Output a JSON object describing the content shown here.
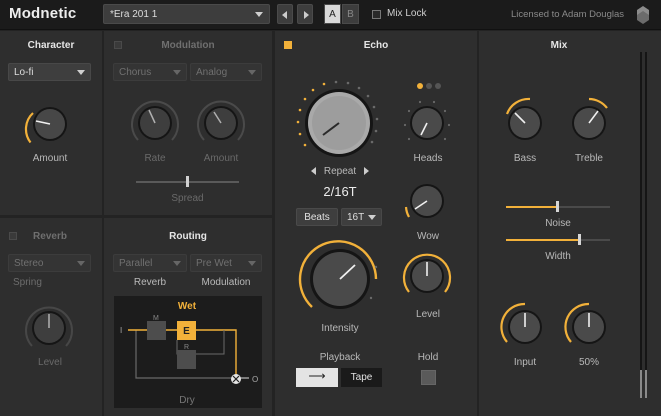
{
  "app": {
    "name": "Modnetic"
  },
  "topbar": {
    "preset": "*Era 201 1",
    "ab_a": "A",
    "ab_b": "B",
    "mix_lock": "Mix Lock",
    "license": "Licensed to Adam Douglas"
  },
  "character": {
    "title": "Character",
    "mode": "Lo-fi",
    "knob_label": "Amount"
  },
  "modulation": {
    "title": "Modulation",
    "type": "Chorus",
    "source": "Analog",
    "rate_label": "Rate",
    "amount_label": "Amount",
    "spread_label": "Spread"
  },
  "echo": {
    "title": "Echo",
    "repeat_label": "Repeat",
    "repeat_value": "2/16T",
    "beats_label": "Beats",
    "division": "16T",
    "heads_label": "Heads",
    "wow_label": "Wow",
    "intensity_label": "Intensity",
    "level_label": "Level",
    "playback_label": "Playback",
    "playback_arrow": "⟶",
    "tape_label": "Tape",
    "hold_label": "Hold"
  },
  "reverb": {
    "title": "Reverb",
    "type": "Stereo",
    "kind": "Spring",
    "level_label": "Level"
  },
  "routing": {
    "title": "Routing",
    "mode": "Parallel",
    "reverb_label": "Reverb",
    "position": "Pre Wet",
    "modulation_label": "Modulation",
    "diagram": {
      "wet": "Wet",
      "dry": "Dry",
      "in": "I",
      "out": "O",
      "m": "M",
      "e": "E",
      "r": "R"
    }
  },
  "mix": {
    "title": "Mix",
    "bass_label": "Bass",
    "treble_label": "Treble",
    "noise_label": "Noise",
    "width_label": "Width",
    "input_label": "Input",
    "output_label": "50%"
  },
  "colors": {
    "accent": "#f2b13a",
    "panel": "#2e2e2e",
    "background": "#232323"
  }
}
